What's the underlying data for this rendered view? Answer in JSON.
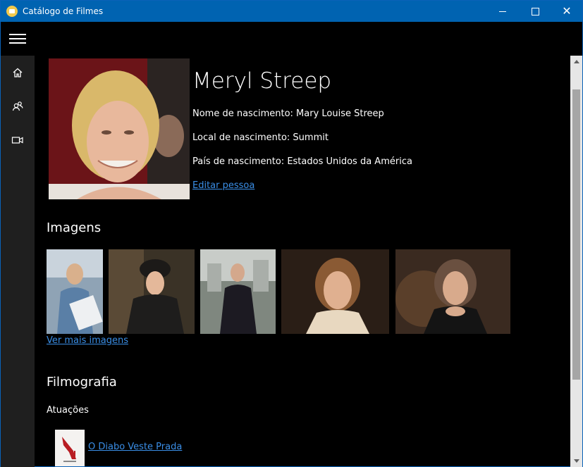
{
  "window": {
    "title": "Catálogo de Filmes"
  },
  "nav": {
    "items": [
      "home-icon",
      "people-icon",
      "movie-camera-icon"
    ]
  },
  "person": {
    "name": "Meryl Streep",
    "birth_name": "Nome de nascimento: Mary Louise Streep",
    "birth_place": "Local de nascimento: Summit",
    "birth_country": "País de nascimento: Estados Unidos da América",
    "edit_label": "Editar pessoa"
  },
  "images": {
    "title": "Imagens",
    "more_label": "Ver mais imagens"
  },
  "filmography": {
    "title": "Filmografia",
    "acting_label": "Atuações",
    "films": [
      {
        "title": "O Diabo Veste Prada"
      }
    ]
  },
  "colors": {
    "titlebar": "#0063b1",
    "link": "#3a8ee6",
    "sidebar": "#1f1f1f",
    "background": "#000000"
  }
}
